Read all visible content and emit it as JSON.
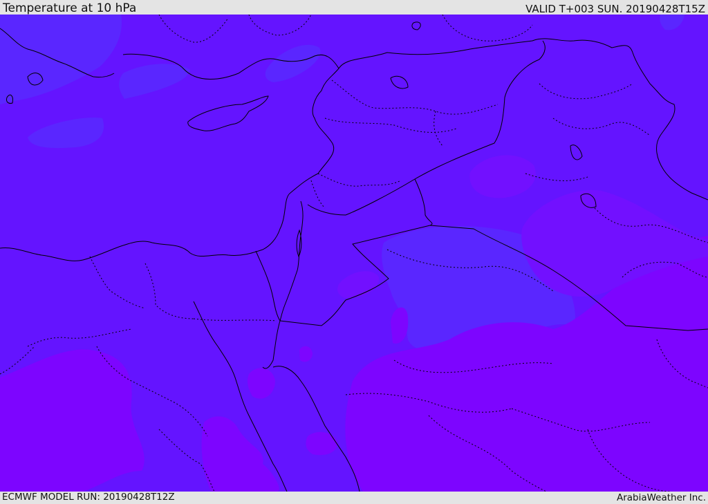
{
  "header": {
    "title": "Temperature at 10 hPa",
    "valid_time": "VALID T+003 SUN. 20190428T15Z"
  },
  "footer": {
    "model_run": "ECMWF MODEL RUN: 20190428T12Z",
    "credit": "ArabiaWeather Inc."
  },
  "colors": {
    "fill_main": "#6414ff",
    "fill_cool": "#5a26ff",
    "fill_warm": "#7d05ff",
    "fill_warm_mid": "#7210ff",
    "border_color": "#000000",
    "header_background": "#e4e4e4"
  }
}
